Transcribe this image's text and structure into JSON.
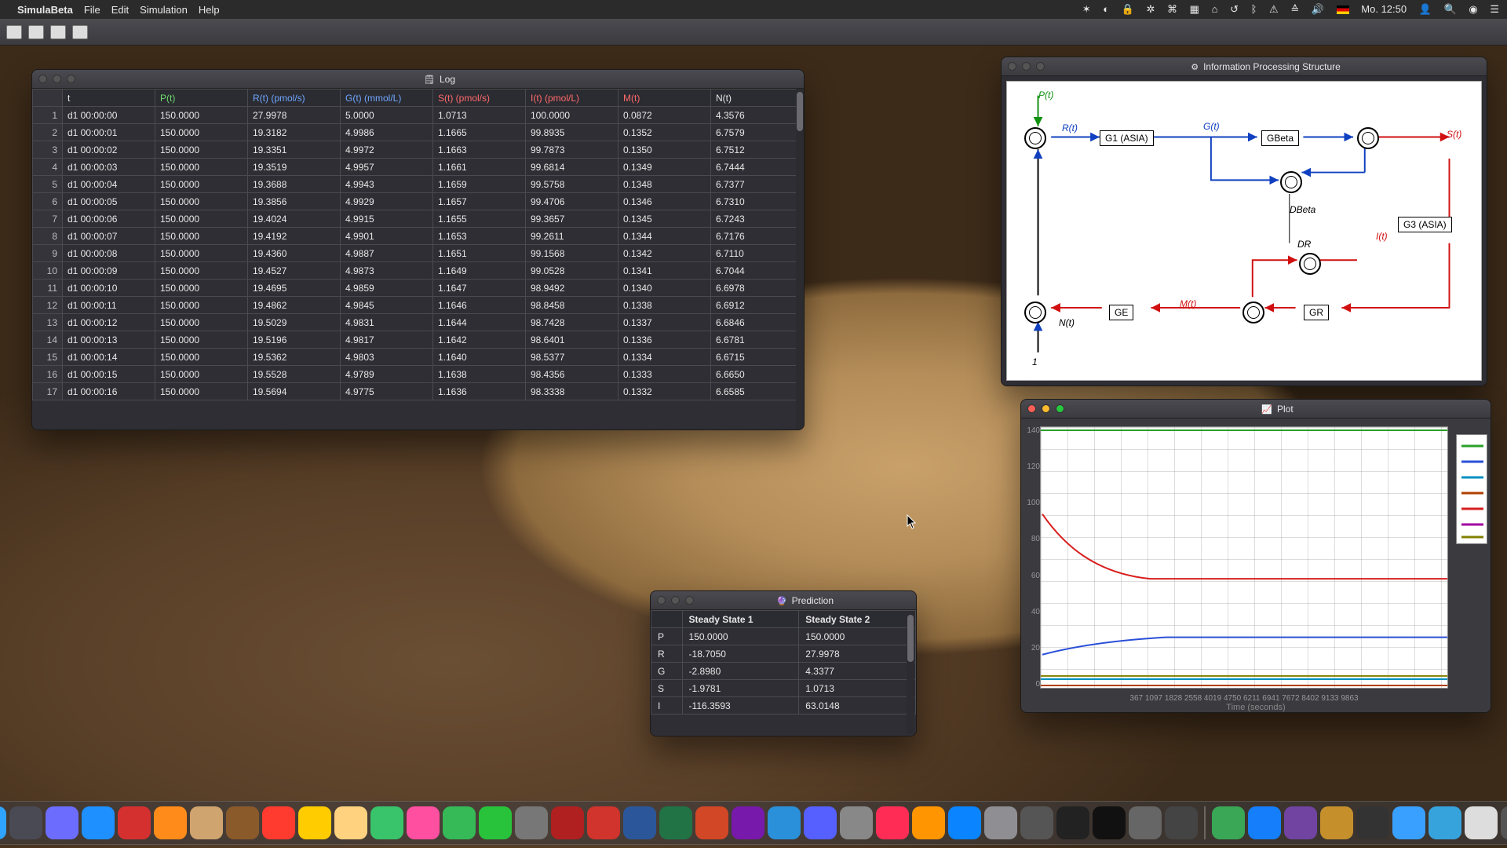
{
  "menubar": {
    "app": "SimulaBeta",
    "items": [
      "File",
      "Edit",
      "Simulation",
      "Help"
    ],
    "right": {
      "clock": "Mo. 12:50"
    }
  },
  "main_title": "SimulaBeta",
  "log": {
    "title": "Log",
    "headers": [
      "",
      "t",
      "P(t)",
      "R(t) (pmol/s)",
      "G(t) (mmol/L)",
      "S(t) (pmol/s)",
      "I(t) (pmol/L)",
      "M(t)",
      "N(t)"
    ],
    "rows": [
      [
        "1",
        "d1 00:00:00",
        "150.0000",
        "27.9978",
        "5.0000",
        "1.0713",
        "100.0000",
        "0.0872",
        "4.3576"
      ],
      [
        "2",
        "d1 00:00:01",
        "150.0000",
        "19.3182",
        "4.9986",
        "1.1665",
        "99.8935",
        "0.1352",
        "6.7579"
      ],
      [
        "3",
        "d1 00:00:02",
        "150.0000",
        "19.3351",
        "4.9972",
        "1.1663",
        "99.7873",
        "0.1350",
        "6.7512"
      ],
      [
        "4",
        "d1 00:00:03",
        "150.0000",
        "19.3519",
        "4.9957",
        "1.1661",
        "99.6814",
        "0.1349",
        "6.7444"
      ],
      [
        "5",
        "d1 00:00:04",
        "150.0000",
        "19.3688",
        "4.9943",
        "1.1659",
        "99.5758",
        "0.1348",
        "6.7377"
      ],
      [
        "6",
        "d1 00:00:05",
        "150.0000",
        "19.3856",
        "4.9929",
        "1.1657",
        "99.4706",
        "0.1346",
        "6.7310"
      ],
      [
        "7",
        "d1 00:00:06",
        "150.0000",
        "19.4024",
        "4.9915",
        "1.1655",
        "99.3657",
        "0.1345",
        "6.7243"
      ],
      [
        "8",
        "d1 00:00:07",
        "150.0000",
        "19.4192",
        "4.9901",
        "1.1653",
        "99.2611",
        "0.1344",
        "6.7176"
      ],
      [
        "9",
        "d1 00:00:08",
        "150.0000",
        "19.4360",
        "4.9887",
        "1.1651",
        "99.1568",
        "0.1342",
        "6.7110"
      ],
      [
        "10",
        "d1 00:00:09",
        "150.0000",
        "19.4527",
        "4.9873",
        "1.1649",
        "99.0528",
        "0.1341",
        "6.7044"
      ],
      [
        "11",
        "d1 00:00:10",
        "150.0000",
        "19.4695",
        "4.9859",
        "1.1647",
        "98.9492",
        "0.1340",
        "6.6978"
      ],
      [
        "12",
        "d1 00:00:11",
        "150.0000",
        "19.4862",
        "4.9845",
        "1.1646",
        "98.8458",
        "0.1338",
        "6.6912"
      ],
      [
        "13",
        "d1 00:00:12",
        "150.0000",
        "19.5029",
        "4.9831",
        "1.1644",
        "98.7428",
        "0.1337",
        "6.6846"
      ],
      [
        "14",
        "d1 00:00:13",
        "150.0000",
        "19.5196",
        "4.9817",
        "1.1642",
        "98.6401",
        "0.1336",
        "6.6781"
      ],
      [
        "15",
        "d1 00:00:14",
        "150.0000",
        "19.5362",
        "4.9803",
        "1.1640",
        "98.5377",
        "0.1334",
        "6.6715"
      ],
      [
        "16",
        "d1 00:00:15",
        "150.0000",
        "19.5528",
        "4.9789",
        "1.1638",
        "98.4356",
        "0.1333",
        "6.6650"
      ],
      [
        "17",
        "d1 00:00:16",
        "150.0000",
        "19.5694",
        "4.9775",
        "1.1636",
        "98.3338",
        "0.1332",
        "6.6585"
      ]
    ]
  },
  "prediction": {
    "title": "Prediction",
    "headers": [
      "",
      "Steady State 1",
      "Steady State 2"
    ],
    "rows": [
      [
        "P",
        "150.0000",
        "150.0000"
      ],
      [
        "R",
        "-18.7050",
        "27.9978"
      ],
      [
        "G",
        "-2.8980",
        "4.3377"
      ],
      [
        "S",
        "-1.9781",
        "1.0713"
      ],
      [
        "I",
        "-116.3593",
        "63.0148"
      ]
    ]
  },
  "structure": {
    "title": "Information Processing Structure",
    "labels": {
      "P": "P(t)",
      "R": "R(t)",
      "G": "G(t)",
      "S": "S(t)",
      "I": "I(t)",
      "M": "M(t)",
      "N": "N(t)",
      "DR": "DR",
      "DBeta": "DBeta",
      "one": "1"
    },
    "nodes": {
      "G1": "G1 (ASIA)",
      "GBeta": "GBeta",
      "G3": "G3 (ASIA)",
      "GE": "GE",
      "GR": "GR"
    }
  },
  "plot": {
    "title": "Plot",
    "xlabel": "Time (seconds)",
    "xticks": "367  1097 1828 2558      4019 4750      6211 6941 7672 8402 9133 9863",
    "yticks": [
      "140",
      "120",
      "100",
      "80",
      "60",
      "40",
      "20",
      "0"
    ]
  },
  "chart_data": {
    "type": "line",
    "title": "Plot",
    "xlabel": "Time (seconds)",
    "ylabel": "",
    "ylim": [
      0,
      150
    ],
    "xlim": [
      0,
      10000
    ],
    "series": [
      {
        "name": "P(t)",
        "color": "#28a028",
        "values_approx": "constant ≈150"
      },
      {
        "name": "R(t)",
        "color": "#2a4fd8",
        "values_approx": "rises from ~20 to ~30, plateau"
      },
      {
        "name": "G(t)",
        "color": "#0090c0",
        "values_approx": "≈5 constant"
      },
      {
        "name": "S(t)",
        "color": "#b04000",
        "values_approx": "≈1 constant"
      },
      {
        "name": "I(t)",
        "color": "#d81e1e",
        "values_approx": "drops from 100 to ~63, plateau"
      },
      {
        "name": "M(t)",
        "color": "#a000a0",
        "values_approx": "≈0.1 constant"
      },
      {
        "name": "N(t)",
        "color": "#808000",
        "values_approx": "≈6.7 constant"
      }
    ]
  },
  "dock": {
    "items": [
      "finder",
      "launchpad",
      "spotlight",
      "safari",
      "opera",
      "firefox",
      "books",
      "contacts",
      "calendar",
      "notes",
      "reminders",
      "maps",
      "photos",
      "messages",
      "facetime",
      "wire",
      "acrobat-folder",
      "acrobat",
      "word",
      "excel",
      "powerpoint",
      "onenote",
      "charts",
      "finder-dup",
      "settings-gear",
      "music",
      "books2",
      "appstore",
      "settings",
      "keychain",
      "monitor",
      "terminal",
      "scanner",
      "drive",
      "pyramid",
      "xcode",
      "app-b",
      "app-beta",
      "circle-app",
      "folder-docs",
      "folder",
      "textedit",
      "trash"
    ]
  }
}
